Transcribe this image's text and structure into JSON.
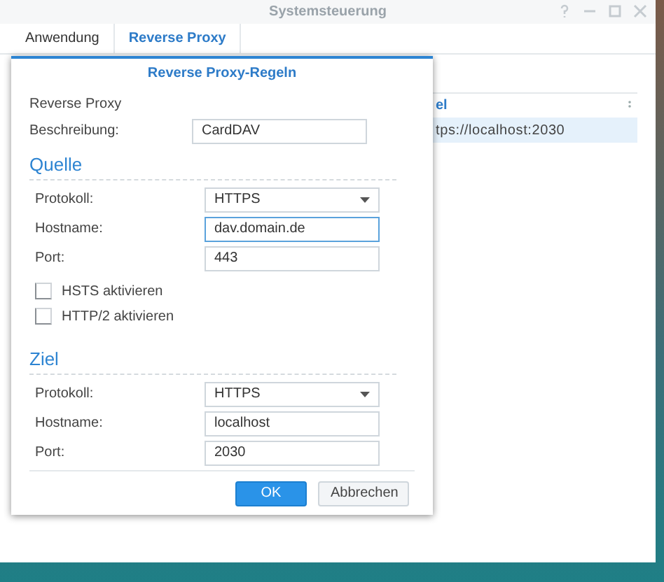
{
  "window": {
    "title": "Systemsteuerung"
  },
  "tabs": [
    {
      "label": "Anwendung",
      "selected": false
    },
    {
      "label": "Reverse Proxy",
      "selected": true
    }
  ],
  "table": {
    "columns": [
      "el"
    ],
    "rows": [
      {
        "cells": [
          "tps://localhost:2030"
        ],
        "selected": true
      }
    ]
  },
  "dialog": {
    "title": "Reverse Proxy-Regeln",
    "subtitle": "Reverse Proxy",
    "description": {
      "label": "Beschreibung:",
      "value": "CardDAV"
    },
    "sections": [
      {
        "title": "Quelle",
        "fields": [
          {
            "kind": "select",
            "label": "Protokoll:",
            "value": "HTTPS",
            "focused": false
          },
          {
            "kind": "text",
            "label": "Hostname:",
            "value": "dav.domain.de",
            "focused": true
          },
          {
            "kind": "text",
            "label": "Port:",
            "value": "443",
            "focused": false
          }
        ],
        "checkboxes": [
          {
            "label": "HSTS aktivieren",
            "checked": false
          },
          {
            "label": "HTTP/2 aktivieren",
            "checked": false
          }
        ]
      },
      {
        "title": "Ziel",
        "fields": [
          {
            "kind": "select",
            "label": "Protokoll:",
            "value": "HTTPS",
            "focused": false
          },
          {
            "kind": "text",
            "label": "Hostname:",
            "value": "localhost",
            "focused": false
          },
          {
            "kind": "text",
            "label": "Port:",
            "value": "2030",
            "focused": false
          }
        ]
      }
    ],
    "buttons": [
      {
        "label": "OK",
        "primary": true
      },
      {
        "label": "Abbrechen",
        "primary": false
      }
    ]
  }
}
